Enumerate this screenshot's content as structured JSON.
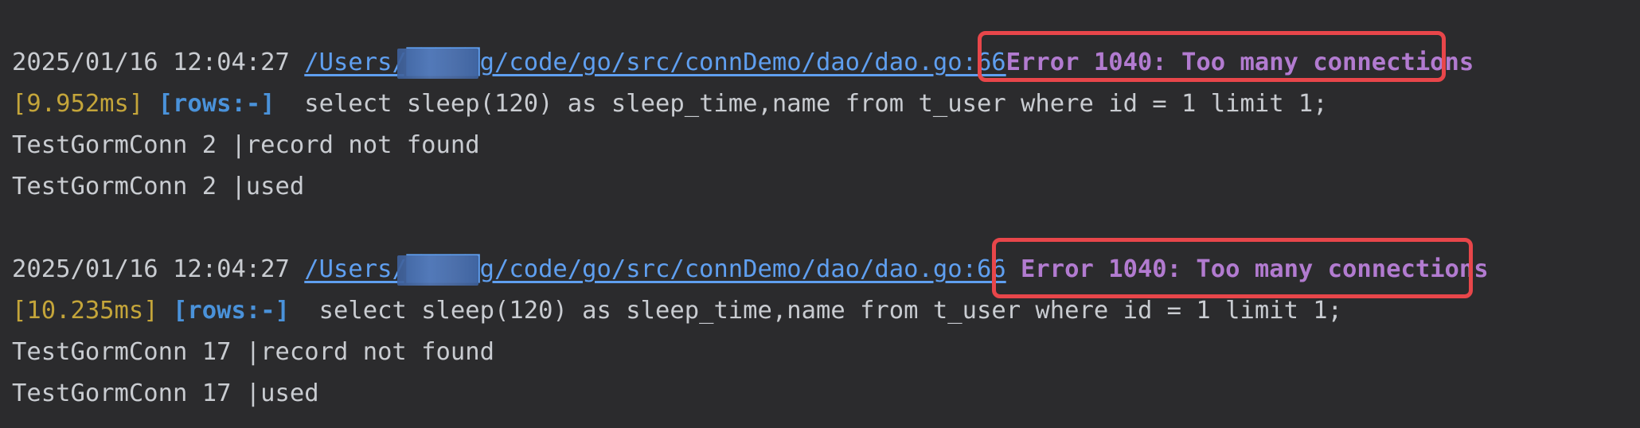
{
  "log_entries": [
    {
      "timestamp": "2025/01/16 12:04:27",
      "path": "/Users/█████g/code/go/src/connDemo/dao/dao.go:66",
      "error": "Error 1040: Too many connections",
      "duration": "[9.952ms]",
      "rows": "[rows:-]",
      "sql": "select sleep(120) as sleep_time,name from t_user where id = 1 limit 1;",
      "messages": [
        "TestGormConn 2 |record not found",
        "TestGormConn 2 |used"
      ]
    },
    {
      "timestamp": "2025/01/16 12:04:27",
      "path": "/Users/█████g/code/go/src/connDemo/dao/dao.go:66",
      "error": "Error 1040: Too many connections",
      "duration": "[10.235ms]",
      "rows": "[rows:-]",
      "sql": "select sleep(120) as sleep_time,name from t_user where id = 1 limit 1;",
      "messages": [
        "TestGormConn 17 |record not found",
        "TestGormConn 17 |used"
      ]
    }
  ],
  "colors": {
    "background": "#2b2b2d",
    "text": "#c9ccd1",
    "link": "#5f9ff0",
    "error": "#b27bd0",
    "duration": "#c4a53a",
    "rows": "#4a92da",
    "annotation_box": "#e8464a"
  }
}
